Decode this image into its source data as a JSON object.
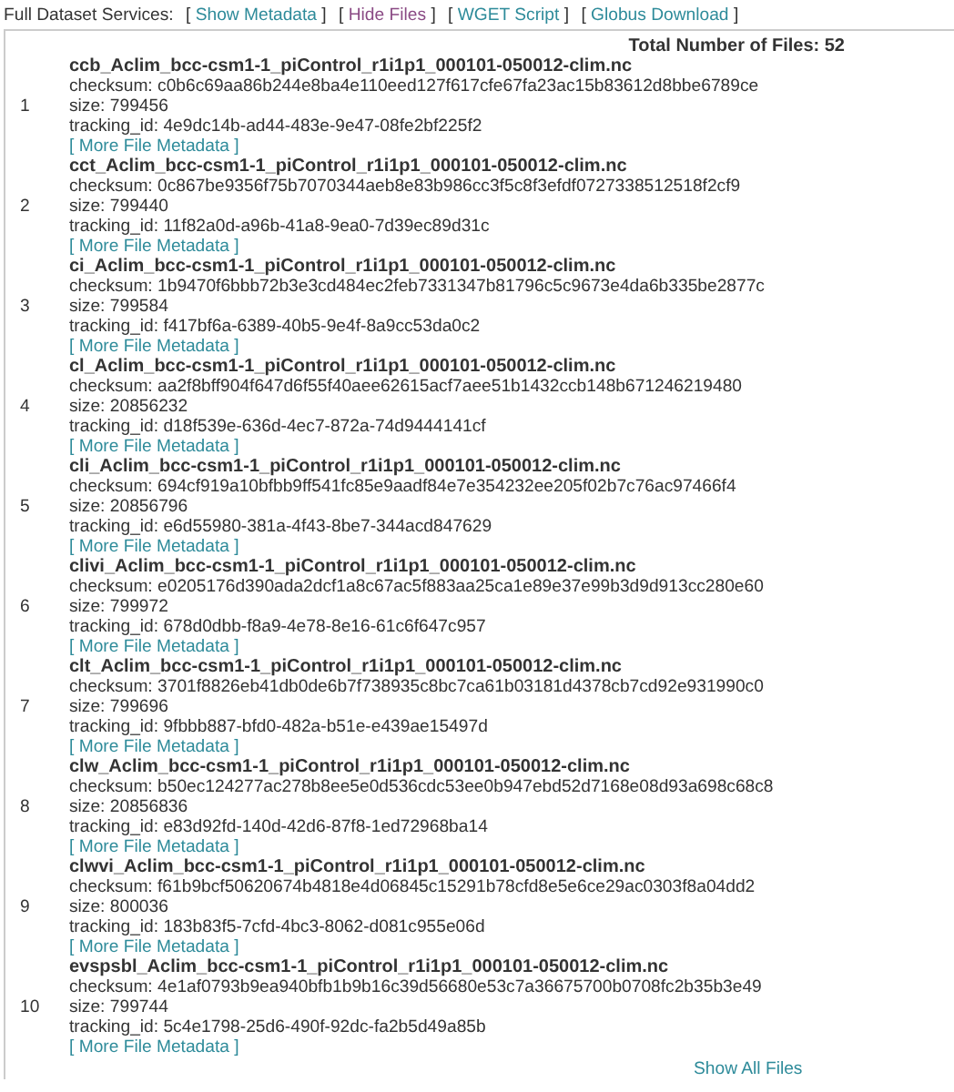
{
  "services": {
    "label": "Full Dataset Services:",
    "links": [
      {
        "open": "[",
        "label": "Show Metadata",
        "close": "]",
        "visited": false
      },
      {
        "open": "[",
        "label": "Hide Files",
        "close": "]",
        "visited": true
      },
      {
        "open": "[",
        "label": "WGET Script",
        "close": "]",
        "visited": false
      },
      {
        "open": "[",
        "label": "Globus Download",
        "close": "]",
        "visited": false
      }
    ]
  },
  "total": "Total Number of Files: 52",
  "files": [
    {
      "number": "1",
      "name": "ccb_Aclim_bcc-csm1-1_piControl_r1i1p1_000101-050012-clim.nc",
      "checksum": "checksum: c0b6c69aa86b244e8ba4e110eed127f617cfe67fa23ac15b83612d8bbe6789ce",
      "size": "size: 799456",
      "tracking_id": "tracking_id: 4e9dc14b-ad44-483e-9e47-08fe2bf225f2",
      "more": "[ More File Metadata ]"
    },
    {
      "number": "2",
      "name": "cct_Aclim_bcc-csm1-1_piControl_r1i1p1_000101-050012-clim.nc",
      "checksum": "checksum: 0c867be9356f75b7070344aeb8e83b986cc3f5c8f3efdf0727338512518f2cf9",
      "size": "size: 799440",
      "tracking_id": "tracking_id: 11f82a0d-a96b-41a8-9ea0-7d39ec89d31c",
      "more": "[ More File Metadata ]"
    },
    {
      "number": "3",
      "name": "ci_Aclim_bcc-csm1-1_piControl_r1i1p1_000101-050012-clim.nc",
      "checksum": "checksum: 1b9470f6bbb72b3e3cd484ec2feb7331347b81796c5c9673e4da6b335be2877c",
      "size": "size: 799584",
      "tracking_id": "tracking_id: f417bf6a-6389-40b5-9e4f-8a9cc53da0c2",
      "more": "[ More File Metadata ]"
    },
    {
      "number": "4",
      "name": "cl_Aclim_bcc-csm1-1_piControl_r1i1p1_000101-050012-clim.nc",
      "checksum": "checksum: aa2f8bff904f647d6f55f40aee62615acf7aee51b1432ccb148b671246219480",
      "size": "size: 20856232",
      "tracking_id": "tracking_id: d18f539e-636d-4ec7-872a-74d9444141cf",
      "more": "[ More File Metadata ]"
    },
    {
      "number": "5",
      "name": "cli_Aclim_bcc-csm1-1_piControl_r1i1p1_000101-050012-clim.nc",
      "checksum": "checksum: 694cf919a10bfbb9ff541fc85e9aadf84e7e354232ee205f02b7c76ac97466f4",
      "size": "size: 20856796",
      "tracking_id": "tracking_id: e6d55980-381a-4f43-8be7-344acd847629",
      "more": "[ More File Metadata ]"
    },
    {
      "number": "6",
      "name": "clivi_Aclim_bcc-csm1-1_piControl_r1i1p1_000101-050012-clim.nc",
      "checksum": "checksum: e0205176d390ada2dcf1a8c67ac5f883aa25ca1e89e37e99b3d9d913cc280e60",
      "size": "size: 799972",
      "tracking_id": "tracking_id: 678d0dbb-f8a9-4e78-8e16-61c6f647c957",
      "more": "[ More File Metadata ]"
    },
    {
      "number": "7",
      "name": "clt_Aclim_bcc-csm1-1_piControl_r1i1p1_000101-050012-clim.nc",
      "checksum": "checksum: 3701f8826eb41db0de6b7f738935c8bc7ca61b03181d4378cb7cd92e931990c0",
      "size": "size: 799696",
      "tracking_id": "tracking_id: 9fbbb887-bfd0-482a-b51e-e439ae15497d",
      "more": "[ More File Metadata ]"
    },
    {
      "number": "8",
      "name": "clw_Aclim_bcc-csm1-1_piControl_r1i1p1_000101-050012-clim.nc",
      "checksum": "checksum: b50ec124277ac278b8ee5e0d536cdc53ee0b947ebd52d7168e08d93a698c68c8",
      "size": "size: 20856836",
      "tracking_id": "tracking_id: e83d92fd-140d-42d6-87f8-1ed72968ba14",
      "more": "[ More File Metadata ]"
    },
    {
      "number": "9",
      "name": "clwvi_Aclim_bcc-csm1-1_piControl_r1i1p1_000101-050012-clim.nc",
      "checksum": "checksum: f61b9bcf50620674b4818e4d06845c15291b78cfd8e5e6ce29ac0303f8a04dd2",
      "size": "size: 800036",
      "tracking_id": "tracking_id: 183b83f5-7cfd-4bc3-8062-d081c955e06d",
      "more": "[ More File Metadata ]"
    },
    {
      "number": "10",
      "name": "evspsbl_Aclim_bcc-csm1-1_piControl_r1i1p1_000101-050012-clim.nc",
      "checksum": "checksum: 4e1af0793b9ea940bfb1b9b16c39d56680e53c7a36675700b0708fc2b35b3e49",
      "size": "size: 799744",
      "tracking_id": "tracking_id: 5c4e1798-25d6-490f-92dc-fa2b5d49a85b",
      "more": "[ More File Metadata ]"
    }
  ],
  "show_all": "Show All Files"
}
